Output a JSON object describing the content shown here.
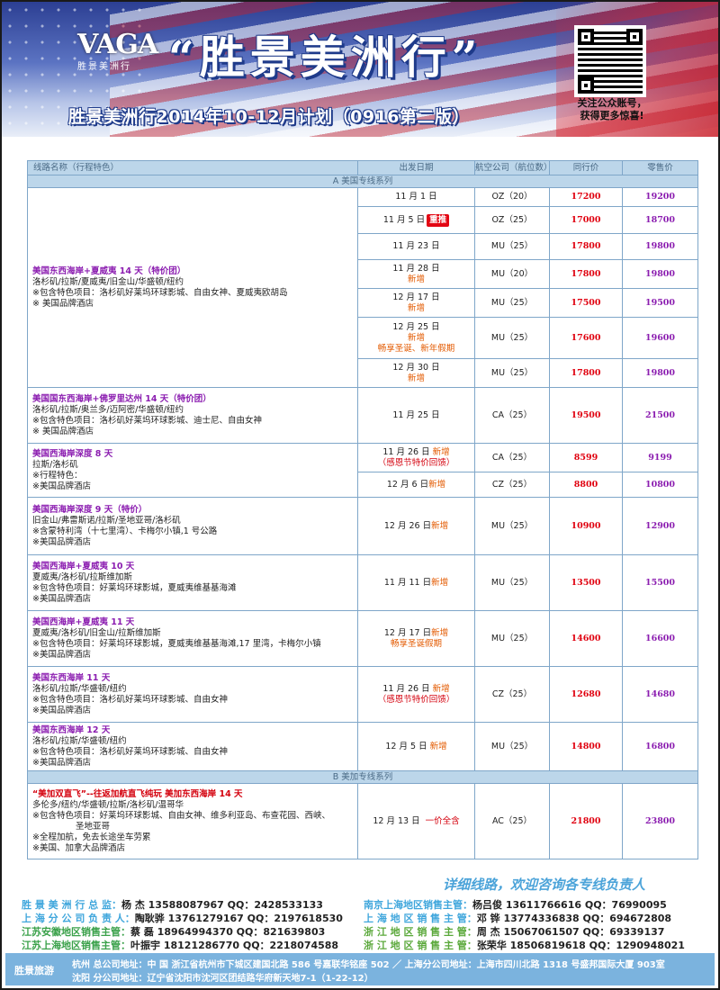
{
  "header": {
    "logo_text": "VAGA",
    "logo_sub": "胜景美洲行",
    "title": "“胜景美洲行”",
    "subtitle": "胜景美洲行2014年10-12月计划（0916第二版）",
    "qr_note_1": "关注公众账号，",
    "qr_note_2": "获得更多惊喜!"
  },
  "table": {
    "headers": [
      "线路名称（行程特色）",
      "出发日期",
      "航空公司（航位数）",
      "同行价",
      "零售价"
    ],
    "section_a": "A 美国专线系列",
    "section_b": "B 美加专线系列",
    "g1": {
      "name": "美国东西海岸+夏威夷 14 天（特价团）",
      "l1": "洛杉矶/拉斯/夏威夷/旧金山/华盛顿/纽约",
      "l2": "※包含特色项目：洛杉矶好莱坞环球影城、自由女神、夏威夷欧胡岛",
      "l3": "※  美国品牌酒店",
      "rows": [
        {
          "date": "11 月 1 日",
          "tag": "",
          "tag2": "",
          "air": "OZ（20）",
          "p1": "17200",
          "p2": "19200"
        },
        {
          "date": "11 月 5 日",
          "tag": "",
          "tag2": "",
          "air": "OZ（25）",
          "p1": "17000",
          "p2": "18700"
        },
        {
          "date": "11 月 23 日",
          "tag": "",
          "tag2": "",
          "air": "MU（25）",
          "p1": "17800",
          "p2": "19800"
        },
        {
          "date": "11 月 28 日",
          "tag": "新增",
          "tag2": "",
          "air": "MU（20）",
          "p1": "17800",
          "p2": "19800"
        },
        {
          "date": "12 月 17 日",
          "tag": "新增",
          "tag2": "",
          "air": "MU（25）",
          "p1": "17500",
          "p2": "19500"
        },
        {
          "date": "12 月 25 日",
          "tag": "新增",
          "tag2": "畅享圣诞、新年假期",
          "air": "MU（25）",
          "p1": "17600",
          "p2": "19600"
        },
        {
          "date": "12 月 30 日",
          "tag": "新增",
          "tag2": "",
          "air": "MU（25）",
          "p1": "17800",
          "p2": "19800"
        }
      ],
      "badge": "重推"
    },
    "g2": {
      "name": "美国国东西海岸+佛罗里达州 14 天（特价团）",
      "l1": "洛杉矶/拉斯/奥兰多/迈阿密/华盛顿/纽约",
      "l2": "※包含特色项目：洛杉矶好莱坞环球影城、迪士尼、自由女神",
      "l3": "※  美国品牌酒店",
      "date": "11 月 25 日",
      "air": "CA（25）",
      "p1": "19500",
      "p2": "21500"
    },
    "g3": {
      "name": "美国西海岸深度 8 天",
      "l1": "拉斯/洛杉矶",
      "l2": "※行程特色：",
      "l3": "※美国品牌酒店",
      "r1": {
        "date": "11 月 26 日",
        "tag": "新增",
        "tag2": "（感恩节特价回馈）",
        "air": "CA（25）",
        "p1": "8599",
        "p2": "9199"
      },
      "r2": {
        "date": "12 月 6 日",
        "tag": "新增",
        "air": "CZ（25）",
        "p1": "8800",
        "p2": "10800"
      }
    },
    "g4": {
      "name": "美国西海岸深度 9 天（特价）",
      "l1": "旧金山/弗雷斯诺/拉斯/圣地亚哥/洛杉矶",
      "l2": "※含蒙特利湾（十七里湾）、卡梅尔小镇,1 号公路",
      "l3": "※美国品牌酒店",
      "date": "12 月 26 日",
      "tag": "新增",
      "air": "MU（25）",
      "p1": "10900",
      "p2": "12900"
    },
    "g5": {
      "name": "美国西海岸+夏威夷 10 天",
      "l1": "夏威夷/洛杉矶/拉斯维加斯",
      "l2": "※包含特色项目：好莱坞环球影城，夏威夷维基基海滩",
      "l3": "※美国品牌酒店",
      "date": "11 月 11 日",
      "tag": "新增",
      "air": "MU（25）",
      "p1": "13500",
      "p2": "15500"
    },
    "g6": {
      "name": "美国西海岸+夏威夷 11 天",
      "l1": "夏威夷/洛杉矶/旧金山/拉斯维加斯",
      "l2": "※包含特色项目：好莱坞环球影城，夏威夷维基基海滩,17 里湾，卡梅尔小镇",
      "l3": "※美国品牌酒店",
      "date": "12 月 17 日",
      "tag": "新增",
      "tag2": "畅享圣诞假期",
      "air": "MU（25）",
      "p1": "14600",
      "p2": "16600"
    },
    "g7": {
      "name": "美国东西海岸 11 天",
      "l1": "洛杉矶/拉斯/华盛顿/纽约",
      "l2": "※包含特色项目：洛杉矶好莱坞环球影城、自由女神",
      "l3": "※美国品牌酒店",
      "date": "11 月 26 日",
      "tag": "新增",
      "tag2": "（感恩节特价回馈）",
      "air": "CZ（25）",
      "p1": "12680",
      "p2": "14680"
    },
    "g8": {
      "name": "美国东西海岸 12 天",
      "l1": "洛杉矶/拉斯/华盛顿/纽约",
      "l2": "※包含特色项目：洛杉矶好莱坞环球影城、自由女神",
      "l3": "※美国品牌酒店",
      "date": "12 月 5 日",
      "tag": "新增",
      "air": "MU（25）",
      "p1": "14800",
      "p2": "16800"
    },
    "g9": {
      "name": "“美加双直飞”--往返加航直飞纯玩   美加东西海岸 14 天",
      "l1": "多伦多/纽约/华盛顿/拉斯/洛杉矶/温哥华",
      "l2": "※包含特色项目：好莱坞环球影城、自由女神、维多利亚岛、布查花园、西峡、",
      "l2b": "圣地亚哥",
      "l3": "※全程加航，免去长途坐车劳累",
      "l4": "※美国、加拿大品牌酒店",
      "date": "12 月 13 日",
      "tag": "一价全含",
      "air": "AC（25）",
      "p1": "21800",
      "p2": "23800"
    }
  },
  "footer": {
    "consult": "详细线路，欢迎咨询各专线负责人",
    "contacts": [
      {
        "role": "胜 景 美 洲 行 总 监：",
        "val": "杨    杰 13588087967  QQ：2428533133"
      },
      {
        "role": "南京上海地区销售主管：",
        "val": "杨吕俊 13611766616  QQ：76990095"
      },
      {
        "role": "上 海 分 公 司 负 责 人：",
        "val": "陶耿骅 13761279167  QQ：2197618530"
      },
      {
        "role": "上 海 地 区 销 售 主 管：",
        "val": "邓    铧 13774336838  QQ：694672808"
      },
      {
        "role": "江苏安徽地区销售主管：",
        "val": "蔡    磊 18964994370  QQ：821639803"
      },
      {
        "role": "浙 江 地 区 销 售 主 管：",
        "val": "周    杰 15067061507  QQ：69339137"
      },
      {
        "role": "江苏上海地区销售主管：",
        "val": "叶振宇 18121286770  QQ：2218074588"
      },
      {
        "role": "浙 江 地 区 销 售 主 管：",
        "val": "张荣华 18506819618  QQ：1290948021"
      }
    ],
    "brand": "胜景旅游",
    "addr1": "杭州 总公司地址：中 国 浙江省杭州市下城区建国北路 586 号嘉联华铭座 502 ／    上海分公司地址：上海市四川北路 1318 号盛邦国际大厦 903室",
    "addr2": "沈阳 分公司地址：辽宁省沈阳市沈河区团结路华府新天地7-1（1-22-12）"
  },
  "colors": {
    "accent_blue": "#3fa6dc",
    "price_red": "#e0000f",
    "price_purple": "#8b1db0",
    "header_blue": "#2c3f93"
  }
}
